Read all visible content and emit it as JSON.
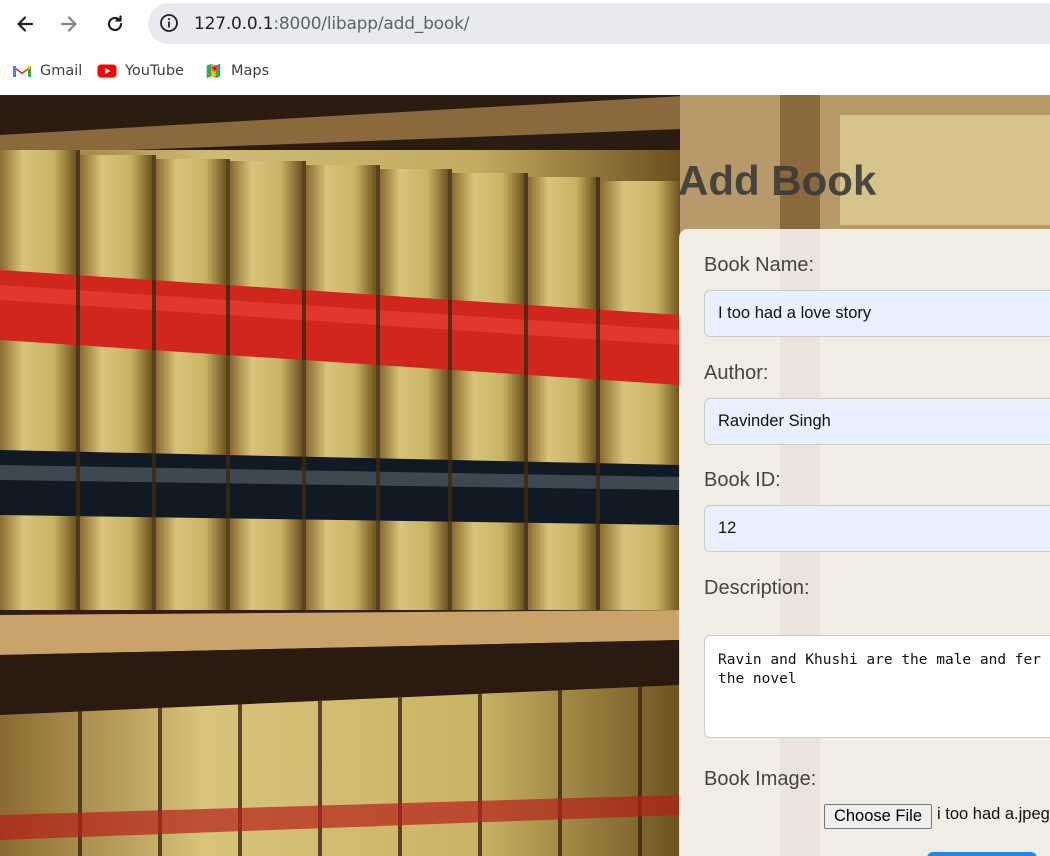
{
  "browser": {
    "url_host": "127.0.0.1",
    "url_path": ":8000/libapp/add_book/",
    "bookmarks": [
      {
        "label": "Gmail",
        "icon": "gmail-icon"
      },
      {
        "label": "YouTube",
        "icon": "youtube-icon"
      },
      {
        "label": "Maps",
        "icon": "maps-icon"
      }
    ]
  },
  "page": {
    "title": "Add Book",
    "form": {
      "book_name_label": "Book Name:",
      "book_name_value": "I too had a love story",
      "author_label": "Author:",
      "author_value": "Ravinder Singh",
      "book_id_label": "Book ID:",
      "book_id_value": "12",
      "description_label": "Description:",
      "description_value": "Ravin and Khushi are the male and fer\nthe novel",
      "image_label": "Book Image:",
      "choose_file_label": "Choose File",
      "file_name": "i too had a.jpeg"
    }
  },
  "colors": {
    "omnibox": "#e8eaed",
    "field_autofill": "#e8f0fe",
    "submit": "#1e88e5"
  }
}
